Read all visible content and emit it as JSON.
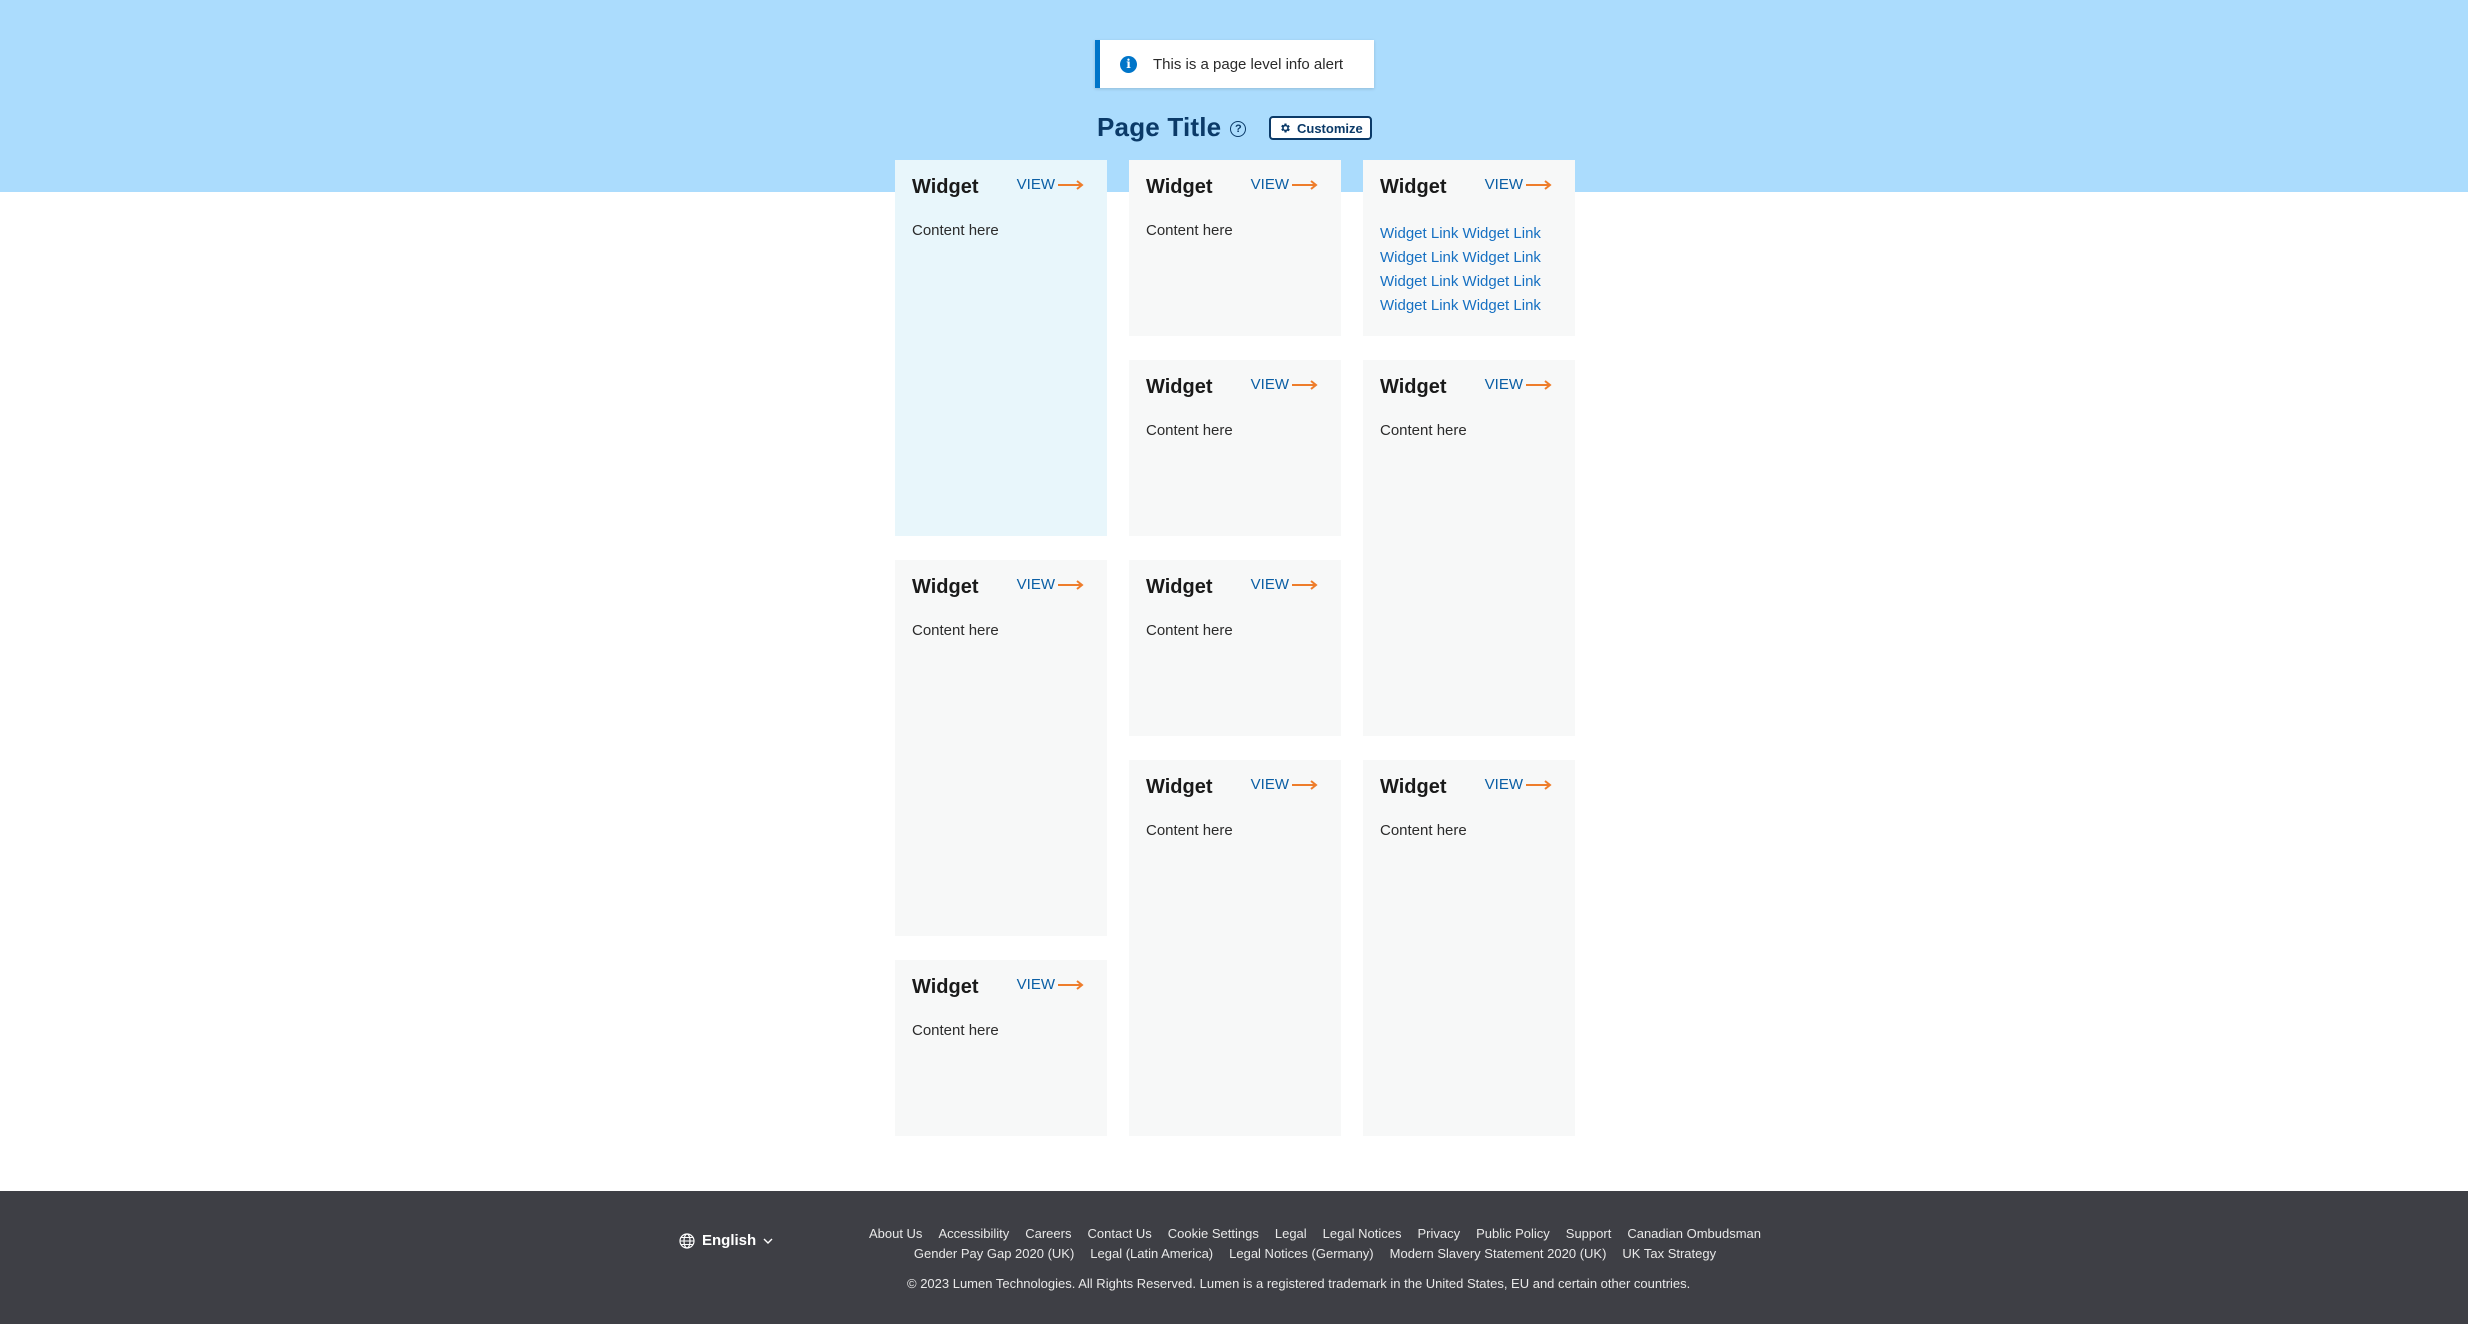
{
  "alert": {
    "text": "This is a page level info alert",
    "icon": "info-icon"
  },
  "header": {
    "title": "Page Title",
    "help_icon": "question-circle-icon",
    "customize_label": "Customize",
    "customize_icon": "gear-icon"
  },
  "widgets": [
    {
      "title": "Widget",
      "view_label": "VIEW",
      "content": "Content here"
    },
    {
      "title": "Widget",
      "view_label": "VIEW",
      "content": "Content here"
    },
    {
      "title": "Widget",
      "view_label": "VIEW",
      "links": [
        "Widget Link Widget Link",
        "Widget Link Widget Link",
        "Widget Link Widget Link",
        "Widget Link Widget Link"
      ]
    },
    {
      "title": "Widget",
      "view_label": "VIEW",
      "content": "Content here"
    },
    {
      "title": "Widget",
      "view_label": "VIEW",
      "content": "Content here"
    },
    {
      "title": "Widget",
      "view_label": "VIEW",
      "content": "Content here"
    },
    {
      "title": "Widget",
      "view_label": "VIEW",
      "content": "Content here"
    },
    {
      "title": "Widget",
      "view_label": "VIEW",
      "content": "Content here"
    },
    {
      "title": "Widget",
      "view_label": "VIEW",
      "content": "Content here"
    },
    {
      "title": "Widget",
      "view_label": "VIEW",
      "content": "Content here"
    }
  ],
  "footer": {
    "language": "English",
    "links_row1": [
      "About Us",
      "Accessibility",
      "Careers",
      "Contact Us",
      "Cookie Settings",
      "Legal",
      "Legal Notices",
      "Privacy",
      "Public Policy",
      "Support",
      "Canadian Ombudsman"
    ],
    "links_row2": [
      "Gender Pay Gap 2020 (UK)",
      "Legal (Latin America)",
      "Legal Notices (Germany)",
      "Modern Slavery Statement 2020 (UK)",
      "UK Tax Strategy"
    ],
    "copyright": "© 2023 Lumen Technologies. All Rights Reserved. Lumen is a registered trademark in the United States, EU and certain other countries."
  },
  "colors": {
    "hero": "#abdcfd",
    "brand_navy": "#0b3a68",
    "link_blue": "#0b5fa5",
    "arrow_orange": "#ee7d2b",
    "footer_bg": "#3e3f45"
  }
}
